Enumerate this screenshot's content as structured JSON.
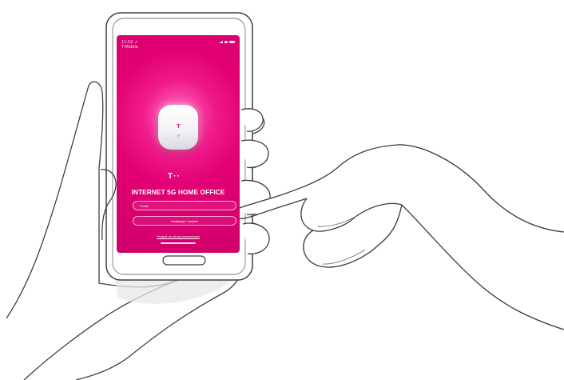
{
  "status_bar": {
    "time": "11:52 ↗",
    "network": "T-Mobile"
  },
  "app": {
    "brand_mark": "T··",
    "title": "INTERNET 5G HOME OFFICE",
    "login_placeholder": "Pokaż",
    "install_button": "Instalacja i montaż",
    "help_link": "Przejdź do strony internetowej",
    "router_logo": "T",
    "brand_color": "#e20074"
  },
  "icons": {
    "signal": "signal-icon",
    "wifi": "wifi-icon",
    "battery": "battery-icon",
    "home_button": "home-button-icon"
  }
}
